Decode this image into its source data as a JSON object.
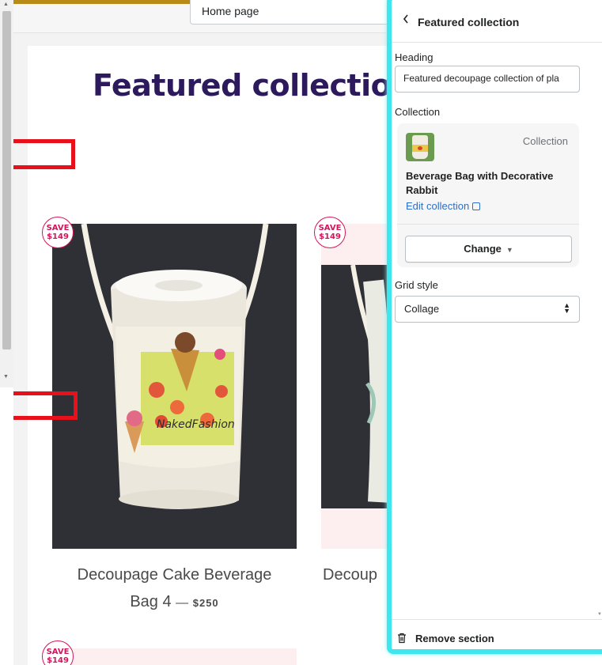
{
  "topbar": {
    "page_select": "Home page"
  },
  "preview": {
    "heading": "Featured collection of",
    "products": [
      {
        "badge_line1": "SAVE",
        "badge_line2": "$149",
        "title_line1": "Decoupage Cake Beverage",
        "title_line2": "Bag 4",
        "price": "$250"
      },
      {
        "badge_line1": "SAVE",
        "badge_line2": "$149",
        "title_partial": "Decoup"
      },
      {
        "badge_line1": "SAVE",
        "badge_line2": "$149"
      }
    ]
  },
  "panel": {
    "back_icon": "chevron-left-icon",
    "title": "Featured collection",
    "heading_label": "Heading",
    "heading_value": "Featured decoupage collection of pla",
    "collection_label": "Collection",
    "collection_type": "Collection",
    "collection_name": "Beverage Bag with Decorative Rabbit",
    "edit_collection": "Edit collection",
    "change_button": "Change",
    "grid_style_label": "Grid style",
    "grid_style_value": "Collage",
    "remove_section": "Remove section"
  },
  "colors": {
    "panel_highlight": "#3ee6ee",
    "annotation_red": "#e8101b",
    "badge_pink": "#d4145a",
    "heading_purple": "#2d1a5c",
    "link_blue": "#2c6ecb"
  }
}
